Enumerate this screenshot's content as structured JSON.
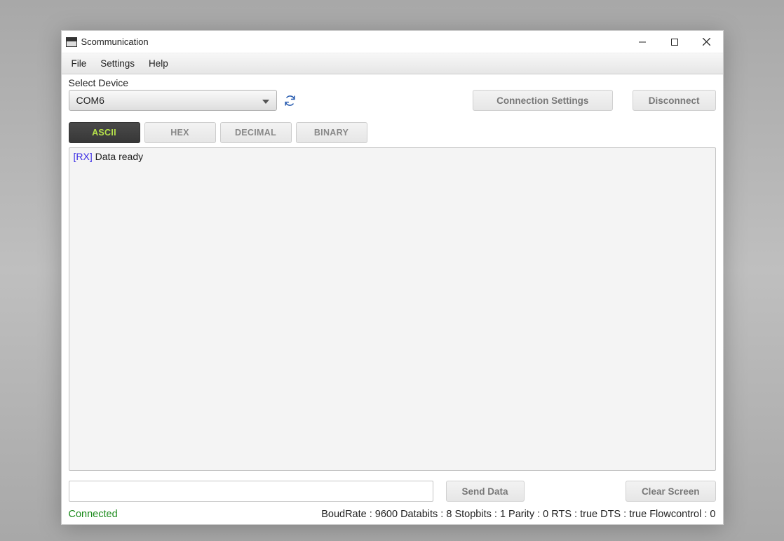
{
  "window": {
    "title": "Scommunication"
  },
  "menu": {
    "items": [
      "File",
      "Settings",
      "Help"
    ]
  },
  "device": {
    "label": "Select Device",
    "selected": "COM6"
  },
  "buttons": {
    "connection_settings": "Connection Settings",
    "disconnect": "Disconnect",
    "send_data": "Send Data",
    "clear_screen": "Clear Screen"
  },
  "tabs": {
    "items": [
      "ASCII",
      "HEX",
      "DECIMAL",
      "BINARY"
    ],
    "active_index": 0
  },
  "console": {
    "lines": [
      {
        "prefix": "[RX]",
        "text": " Data ready"
      }
    ]
  },
  "input": {
    "value": ""
  },
  "status": {
    "connected_text": "Connected",
    "detail": "BoudRate : 9600 Databits : 8 Stopbits : 1 Parity : 0 RTS : true DTS : true Flowcontrol : 0"
  }
}
